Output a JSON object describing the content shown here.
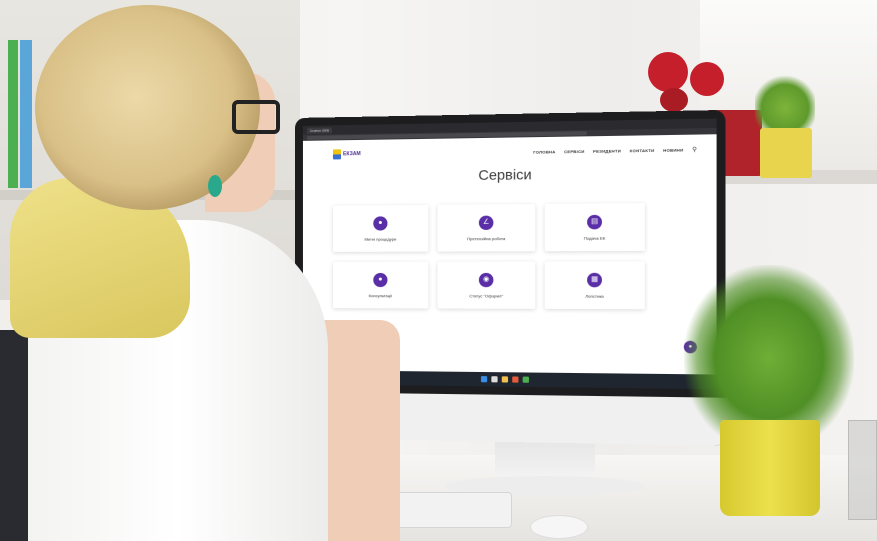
{
  "browser": {
    "tab_title": "Сервіси | ЕКБ",
    "url": ""
  },
  "site": {
    "logo_text": "ЕКЗАМ",
    "nav": [
      "ГОЛОВНА",
      "СЕРВІСИ",
      "РЕЗИДЕНТИ",
      "КОНТАКТИ",
      "НОВИНИ"
    ],
    "title": "Сервіси",
    "subtitle": "",
    "services": [
      {
        "label": "Митні процедури",
        "icon": "globe-icon"
      },
      {
        "label": "Претензійна робота",
        "icon": "chart-icon"
      },
      {
        "label": "Подача ЕК",
        "icon": "document-icon"
      },
      {
        "label": "Консультації",
        "icon": "people-icon"
      },
      {
        "label": "Статус \"Оформл\"",
        "icon": "badge-icon"
      },
      {
        "label": "Логістика",
        "icon": "calculator-icon"
      }
    ]
  },
  "taskbar": {
    "time": "",
    "date": ""
  },
  "colors": {
    "accent": "#5a2ea6"
  }
}
